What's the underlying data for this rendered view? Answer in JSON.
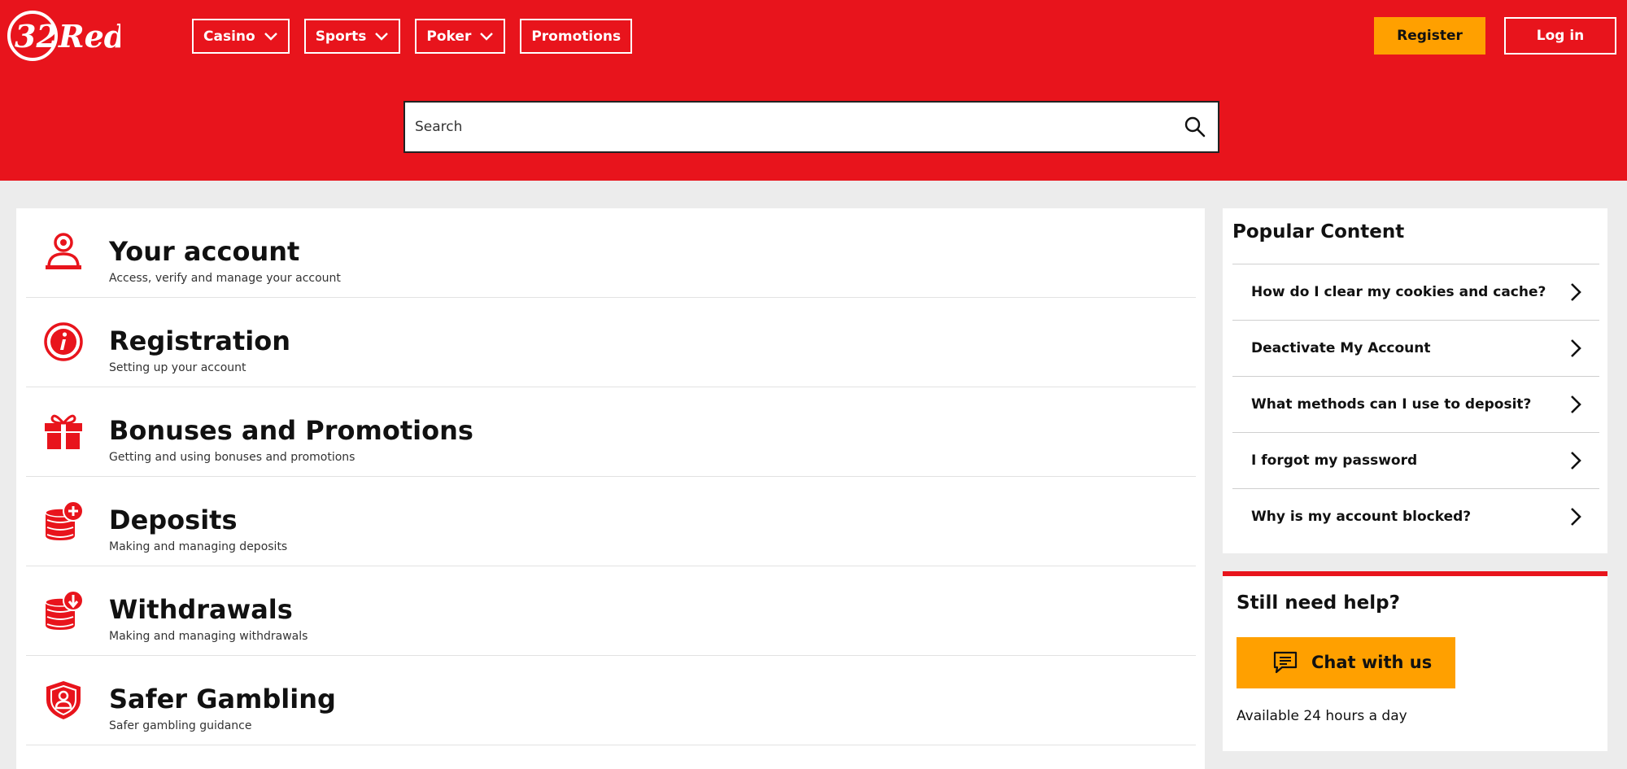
{
  "brand": {
    "logo_text": "32Red",
    "primary_color": "#e8141c",
    "accent_color": "#ffa000"
  },
  "nav": {
    "items": [
      {
        "label": "Casino",
        "has_dropdown": true
      },
      {
        "label": "Sports",
        "has_dropdown": true
      },
      {
        "label": "Poker",
        "has_dropdown": true
      },
      {
        "label": "Promotions",
        "has_dropdown": false
      }
    ],
    "register_label": "Register",
    "login_label": "Log in"
  },
  "search": {
    "placeholder": "Search",
    "value": "",
    "icon": "search-icon"
  },
  "categories": [
    {
      "title": "Your account",
      "description": "Access, verify and manage your account",
      "icon": "user-icon"
    },
    {
      "title": "Registration",
      "description": "Setting up your account",
      "icon": "info-icon"
    },
    {
      "title": "Bonuses and Promotions",
      "description": "Getting and using bonuses and promotions",
      "icon": "gift-icon"
    },
    {
      "title": "Deposits",
      "description": "Making and managing deposits",
      "icon": "coins-plus-icon"
    },
    {
      "title": "Withdrawals",
      "description": "Making and managing withdrawals",
      "icon": "coins-down-icon"
    },
    {
      "title": "Safer Gambling",
      "description": "Safer gambling guidance",
      "icon": "shield-icon"
    }
  ],
  "popular": {
    "title": "Popular Content",
    "items": [
      "How do I clear my cookies and cache?",
      "Deactivate My Account",
      "What methods can I use to deposit?",
      "I forgot my password",
      "Why is my account blocked?"
    ]
  },
  "help": {
    "title": "Still need help?",
    "chat_label": "Chat with us",
    "availability": "Available 24 hours a day"
  }
}
